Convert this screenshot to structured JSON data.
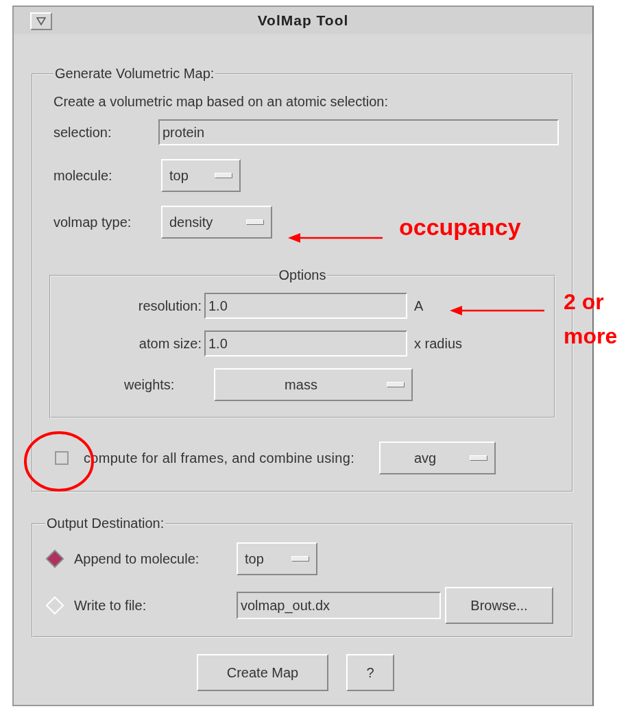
{
  "window": {
    "title": "VolMap Tool"
  },
  "generate": {
    "legend": "Generate Volumetric Map:",
    "intro": "Create a volumetric map based on an atomic selection:",
    "selection": {
      "label": "selection:",
      "value": "protein"
    },
    "molecule": {
      "label": "molecule:",
      "value": "top"
    },
    "volmap_type": {
      "label": "volmap type:",
      "value": "density"
    },
    "options": {
      "legend": "Options",
      "resolution": {
        "label": "resolution:",
        "value": "1.0",
        "unit": "A"
      },
      "atom_size": {
        "label": "atom size:",
        "value": "1.0",
        "unit": "x radius"
      },
      "weights": {
        "label": "weights:",
        "value": "mass"
      }
    },
    "all_frames": {
      "label": "compute for all frames, and combine using:",
      "checked": false,
      "combine": "avg"
    }
  },
  "output": {
    "legend": "Output Destination:",
    "options": [
      {
        "kind": "menu",
        "label": "Append to molecule:",
        "selected": true,
        "value": "top"
      },
      {
        "kind": "file",
        "label": "Write to file:",
        "selected": false,
        "value": "volmap_out.dx",
        "button": "Browse..."
      }
    ]
  },
  "buttons": [
    "Create Map",
    "?"
  ],
  "annotations": [
    {
      "lines": [
        "occupancy"
      ]
    },
    {
      "lines": [
        "2 or",
        "more"
      ]
    }
  ]
}
